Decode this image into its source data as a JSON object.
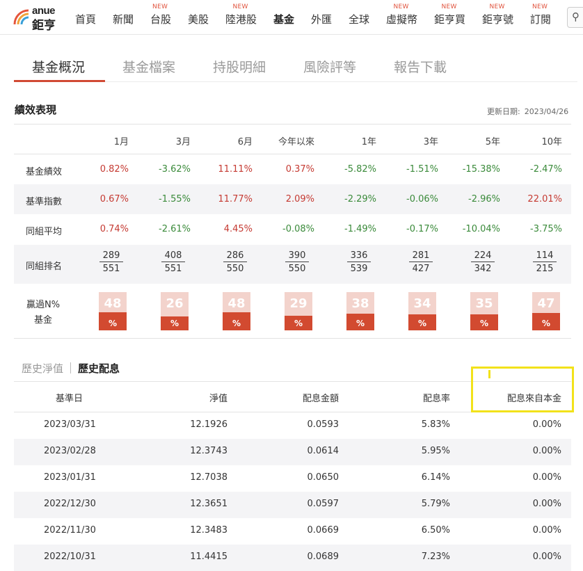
{
  "brand": {
    "line1": "anue",
    "line2": "鉅亨"
  },
  "nav": [
    {
      "label": "首頁",
      "is_new": false
    },
    {
      "label": "新聞",
      "is_new": false
    },
    {
      "label": "台股",
      "is_new": true
    },
    {
      "label": "美股",
      "is_new": false
    },
    {
      "label": "陸港股",
      "is_new": true
    },
    {
      "label": "基金",
      "is_new": false,
      "active": true
    },
    {
      "label": "外匯",
      "is_new": false
    },
    {
      "label": "全球",
      "is_new": false
    },
    {
      "label": "虛擬幣",
      "is_new": true
    },
    {
      "label": "鉅亨買",
      "is_new": true
    },
    {
      "label": "鉅亨號",
      "is_new": true
    },
    {
      "label": "訂閱",
      "is_new": true
    }
  ],
  "new_badge": "NEW",
  "search_icon_name": "search-icon",
  "tabs": [
    "基金概況",
    "基金檔案",
    "持股明細",
    "風險評等",
    "報告下載"
  ],
  "performance": {
    "title": "績效表現",
    "update_label": "更新日期:",
    "update_date": "2023/04/26",
    "periods": [
      "1月",
      "3月",
      "6月",
      "今年以來",
      "1年",
      "3年",
      "5年",
      "10年"
    ],
    "rows": [
      {
        "label": "基金績效",
        "values": [
          "0.82%",
          "-3.62%",
          "11.11%",
          "0.37%",
          "-5.82%",
          "-1.51%",
          "-15.38%",
          "-2.47%"
        ]
      },
      {
        "label": "基準指數",
        "values": [
          "0.67%",
          "-1.55%",
          "11.77%",
          "2.09%",
          "-2.29%",
          "-0.06%",
          "-2.96%",
          "22.01%"
        ]
      },
      {
        "label": "同組平均",
        "values": [
          "0.74%",
          "-2.61%",
          "4.45%",
          "-0.08%",
          "-1.49%",
          "-0.17%",
          "-10.04%",
          "-3.75%"
        ]
      }
    ],
    "rank_label": "同組排名",
    "ranks": [
      {
        "rank": "289",
        "total": "551"
      },
      {
        "rank": "408",
        "total": "551"
      },
      {
        "rank": "286",
        "total": "550"
      },
      {
        "rank": "390",
        "total": "550"
      },
      {
        "rank": "336",
        "total": "539"
      },
      {
        "rank": "281",
        "total": "427"
      },
      {
        "rank": "224",
        "total": "342"
      },
      {
        "rank": "114",
        "total": "215"
      }
    ],
    "beat_label_1": "贏過N%",
    "beat_label_2": "基金",
    "beat_unit": "%",
    "beat_pct": [
      48,
      26,
      48,
      29,
      38,
      34,
      35,
      47
    ],
    "colors": {
      "positive": "#c53a32",
      "negative": "#3a8a3a",
      "gauge_fill": "#d24a30",
      "gauge_bg": "#f3d3cc"
    }
  },
  "history": {
    "tab_nav": "歷史淨值",
    "tab_div": "歷史配息",
    "headers": [
      "基準日",
      "淨值",
      "配息金額",
      "配息率",
      "配息來自本金"
    ],
    "rows": [
      [
        "2023/03/31",
        "12.1926",
        "0.0593",
        "5.83%",
        "0.00%"
      ],
      [
        "2023/02/28",
        "12.3743",
        "0.0614",
        "5.95%",
        "0.00%"
      ],
      [
        "2023/01/31",
        "12.7038",
        "0.0650",
        "6.14%",
        "0.00%"
      ],
      [
        "2022/12/30",
        "12.3651",
        "0.0597",
        "5.79%",
        "0.00%"
      ],
      [
        "2022/11/30",
        "12.3483",
        "0.0669",
        "6.50%",
        "0.00%"
      ],
      [
        "2022/10/31",
        "11.4415",
        "0.0689",
        "7.23%",
        "0.00%"
      ]
    ]
  }
}
